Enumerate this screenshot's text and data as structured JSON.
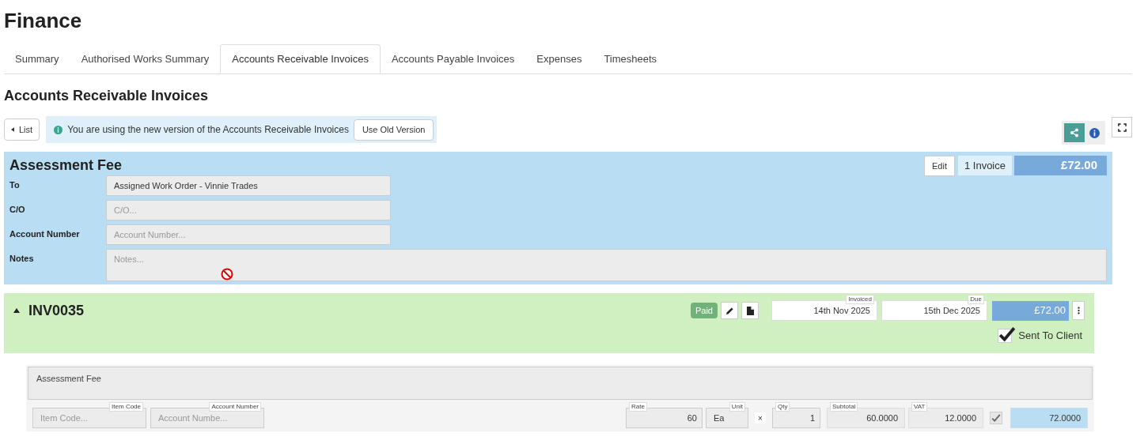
{
  "page_title": "Finance",
  "tabs": [
    {
      "label": "Summary",
      "selected": false
    },
    {
      "label": "Authorised Works Summary",
      "selected": false
    },
    {
      "label": "Accounts Receivable Invoices",
      "selected": true
    },
    {
      "label": "Accounts Payable Invoices",
      "selected": false
    },
    {
      "label": "Expenses",
      "selected": false
    },
    {
      "label": "Timesheets",
      "selected": false
    }
  ],
  "section_title": "Accounts Receivable Invoices",
  "list_button": "List",
  "notice": {
    "text": "You are using the new version of the Accounts Receivable Invoices",
    "button": "Use Old Version"
  },
  "group": {
    "title": "Assessment Fee",
    "edit_button": "Edit",
    "invoice_count": "1 Invoice",
    "total": "£72.00",
    "fields": [
      {
        "label": "To",
        "value": "Assigned Work Order - Vinnie Trades",
        "kind": "line"
      },
      {
        "label": "C/O",
        "placeholder": "C/O...",
        "kind": "line"
      },
      {
        "label": "Account Number",
        "placeholder": "Account Number...",
        "kind": "line"
      },
      {
        "label": "Notes",
        "placeholder": "Notes...",
        "kind": "area"
      }
    ]
  },
  "invoice": {
    "number": "INV0035",
    "expanded": true,
    "status": "Paid",
    "invoiced_label": "Invoiced",
    "invoiced": "14th Nov 2025",
    "due_label": "Due",
    "due": "15th Dec 2025",
    "total": "£72.00",
    "sent_label": "Sent To Client",
    "sent_to_client": true,
    "line": {
      "description": "Assessment Fee",
      "left_fields": [
        {
          "label": "Item Code",
          "placeholder": "Item Code..."
        },
        {
          "label": "Account Number",
          "placeholder": "Account Numbe..."
        }
      ],
      "rate_label": "Rate",
      "rate": "60",
      "unit_label": "Unit",
      "unit": "Ea",
      "times": "×",
      "qty_label": "Qty",
      "qty": "1",
      "subtotal_label": "Subtotal",
      "subtotal": "60.0000",
      "vat_label": "VAT",
      "vat": "12.0000",
      "vat_checked": true,
      "total": "72.0000"
    }
  }
}
